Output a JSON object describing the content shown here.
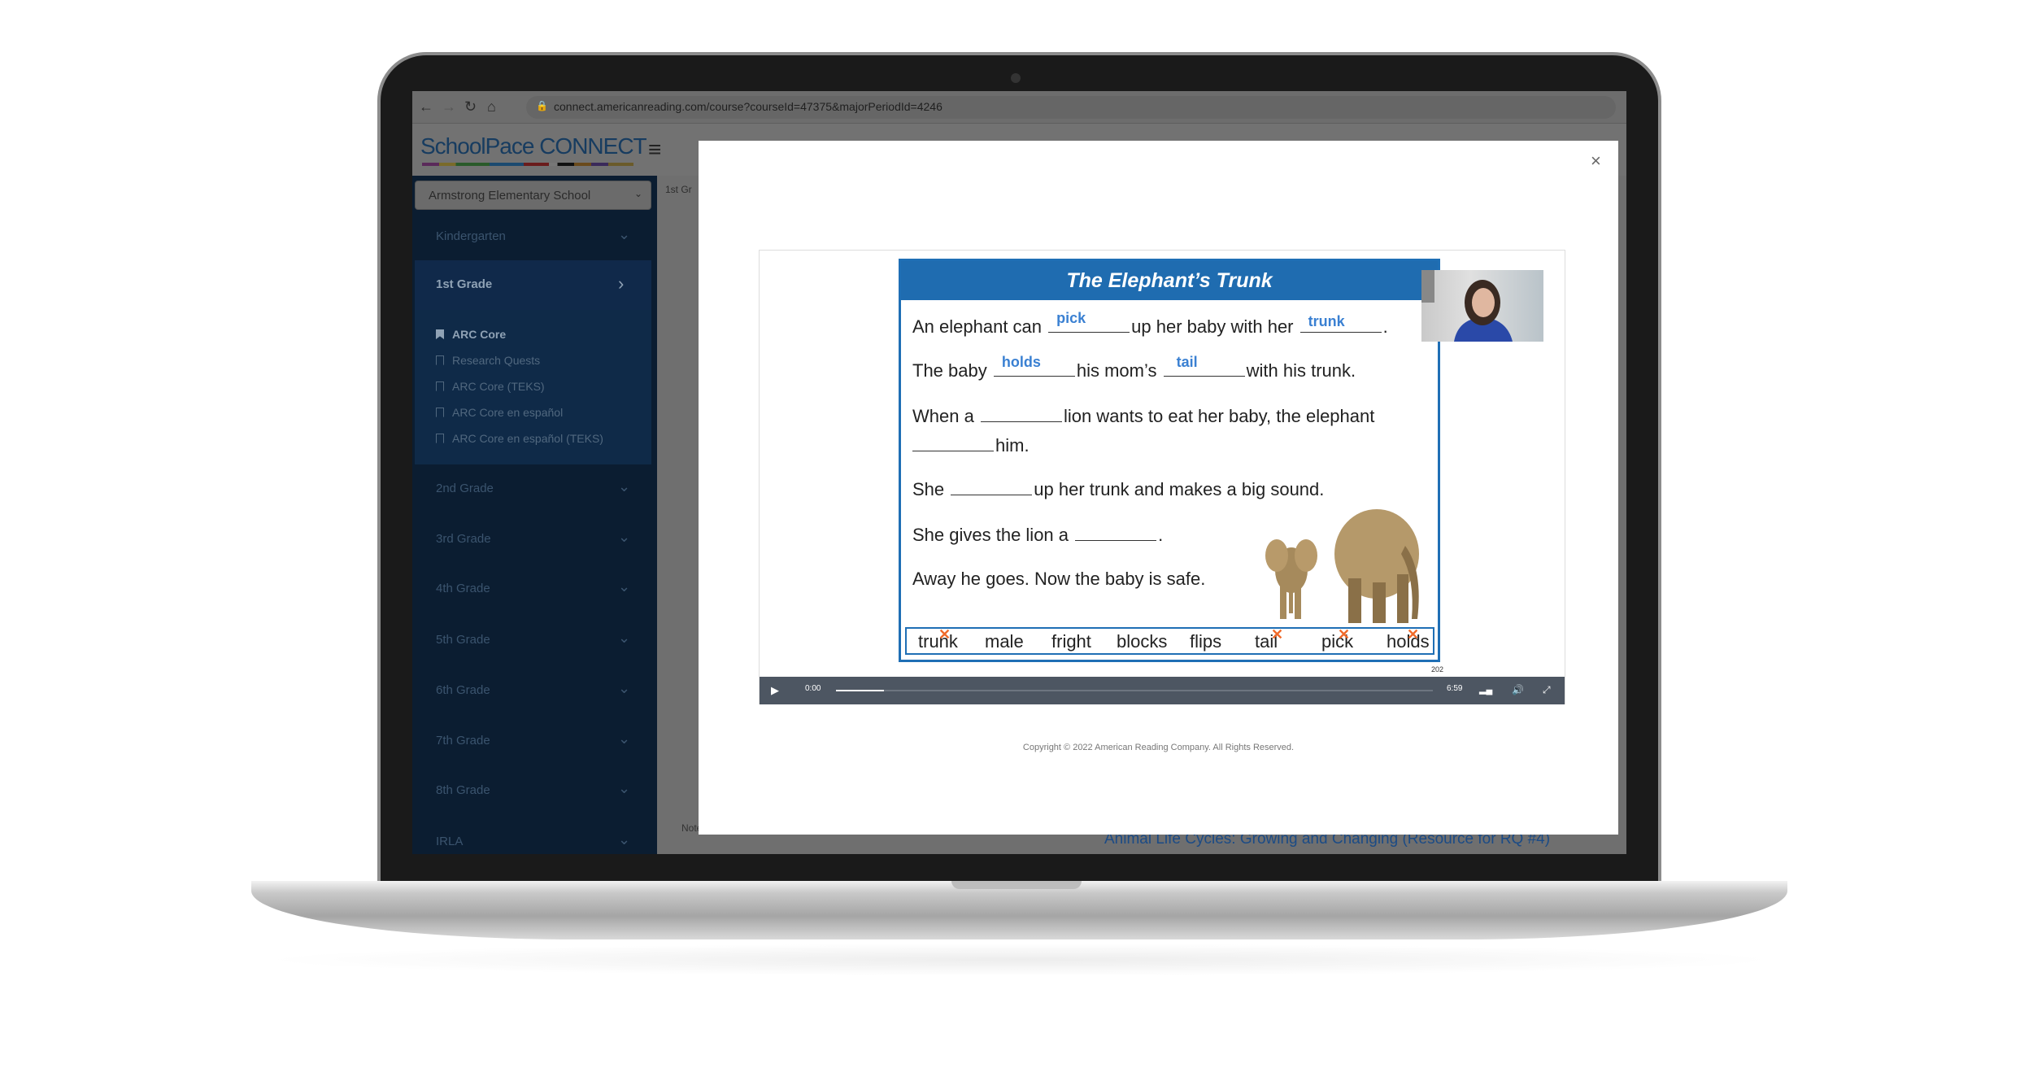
{
  "browser": {
    "url": "connect.americanreading.com/course?courseId=47375&majorPeriodId=4246"
  },
  "header": {
    "logo": "SchoolPace CONNECT"
  },
  "sidebar": {
    "school": "Armstrong Elementary School",
    "kindergarten": "Kindergarten",
    "first_grade": "1st Grade",
    "sub_items": [
      {
        "label": "ARC Core",
        "active": true
      },
      {
        "label": "Research Quests"
      },
      {
        "label": "ARC Core (TEKS)"
      },
      {
        "label": "ARC Core en español"
      },
      {
        "label": "ARC Core en español (TEKS)"
      }
    ],
    "grades": [
      "2nd Grade",
      "3rd Grade",
      "4th Grade",
      "5th Grade",
      "6th Grade",
      "7th Grade",
      "8th Grade",
      "IRLA"
    ]
  },
  "main": {
    "breadcrumb": "1st Gr",
    "behind_title": "Animal Life Cycles: Growing and Changing (Resource for RQ #4)",
    "behind_note": "Notebook"
  },
  "modal": {
    "close": "×",
    "worksheet": {
      "title": "The Elephant’s Trunk",
      "l1a": "An elephant can",
      "a1": "pick",
      "l1b": "up her baby with her",
      "a2": "trunk",
      "l1c": ".",
      "l2a": "The baby",
      "a3": "holds",
      "l2b": "his mom’s",
      "a4": "tail",
      "l2c": "with his trunk.",
      "l3a": "When a",
      "l3b": "lion wants to eat her baby, the elephant",
      "l4": "him.",
      "l5a": "She",
      "l5b": "up her trunk and makes a big sound.",
      "l6a": "She gives the lion a",
      "l6b": ".",
      "l7": "Away he goes. Now the baby is safe.",
      "word_bank": [
        {
          "w": "trunk",
          "crossed": true
        },
        {
          "w": "male"
        },
        {
          "w": "fright"
        },
        {
          "w": "blocks"
        },
        {
          "w": "flips"
        },
        {
          "w": "tail",
          "crossed": true
        },
        {
          "w": "pick",
          "crossed": true
        },
        {
          "w": "holds",
          "crossed": true
        }
      ],
      "page": "202"
    },
    "player": {
      "current": "0:00",
      "duration": "6:59",
      "progress": 0.08
    },
    "copyright": "Copyright © 2022 American Reading Company. All Rights Reserved."
  },
  "colors": {
    "accent": "#1f6cb0",
    "answer": "#3a80d2",
    "cross": "#f06a2a",
    "sidebar": "#0b1d31"
  }
}
